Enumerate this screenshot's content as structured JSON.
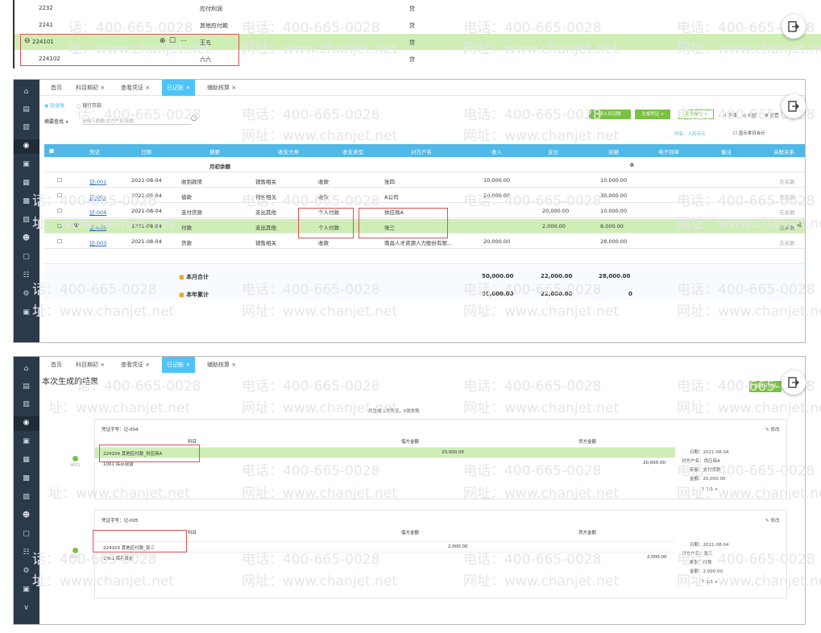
{
  "watermark": {
    "phone": "电话：400-665-0028",
    "site": "网址：www.chanjet.net",
    "phone_short": "话：400-665-0028",
    "site_short": "址：www.chanjet.net"
  },
  "panel1": {
    "rows": [
      {
        "code": "2232",
        "name": "应付利润",
        "dir": "贷"
      },
      {
        "code": "2241",
        "name": "其他应付款",
        "dir": "贷"
      },
      {
        "code": "224101",
        "name": "王五",
        "dir": "贷"
      },
      {
        "code": "224102",
        "name": "六六",
        "dir": "贷"
      }
    ]
  },
  "panel2": {
    "tabs": [
      "首页",
      "科目期初 ×",
      "查看凭证 ×",
      "日记账 ×",
      "辅助核算 ×"
    ],
    "subtabs": [
      "现金账",
      "银行存款"
    ],
    "search_scope": "摘要查找",
    "search_placeholder": "请输入摘要/对方户名/金额",
    "toolbar": {
      "import": "导入日记账",
      "gen_voucher": "生成凭证 ∨",
      "more": "更多操作 ∨",
      "download": "下载",
      "view": "视图",
      "settings": "设置",
      "unit_label": "所有：人民币元",
      "show_today": "显示本日合计"
    },
    "columns": [
      "凭证",
      "日期",
      "摘要",
      "收支大类",
      "收支类型",
      "对方户名",
      "收入",
      "支出",
      "余额",
      "电子回单",
      "备注",
      "关联关系"
    ],
    "opening_label": "月初余额",
    "opening_balance": "0",
    "rows": [
      {
        "voucher": "记-001",
        "date": "2021-08-04",
        "summary": "收到款项",
        "category": "销售相关",
        "type": "收款",
        "party": "张四",
        "income": "10,000.00",
        "expense": "",
        "balance": "10,000.00",
        "link": "去关联"
      },
      {
        "voucher": "记-002",
        "date": "2021-08-04",
        "summary": "借款",
        "category": "销售相关",
        "type": "收款",
        "party": "A公司",
        "income": "20,000.00",
        "expense": "",
        "balance": "30,000.00",
        "link": "去关联"
      },
      {
        "voucher": "记-004",
        "date": "2021-08-04",
        "summary": "支付货款",
        "category": "支出其他",
        "type": "个人付款",
        "party": "供应商A",
        "income": "",
        "expense": "20,000.00",
        "balance": "10,000.00",
        "link": "去关联"
      },
      {
        "voucher": "记-005",
        "date": "2021-08-04",
        "summary": "付款",
        "category": "支出其他",
        "type": "个人付款",
        "party": "张三",
        "income": "",
        "expense": "2,000.00",
        "balance": "8,000.00",
        "link": "去关联"
      },
      {
        "voucher": "记-003",
        "date": "2021-08-04",
        "summary": "货款",
        "category": "销售相关",
        "type": "收款",
        "party": "南昌人才资源人力股份有限...",
        "income": "20,000.00",
        "expense": "",
        "balance": "28,000.00",
        "link": "去关联"
      }
    ],
    "month_total": {
      "label": "本月合计",
      "income": "50,000.00",
      "expense": "22,000.00",
      "balance": "28,000.00"
    },
    "year_total": {
      "label": "本年累计",
      "income": "50,000.00",
      "expense": "22,000.00",
      "balance": "0"
    }
  },
  "panel3": {
    "tabs": [
      "首页",
      "科目期初 ×",
      "查看凭证 ×",
      "日记账 ×",
      "辅助核算 ×"
    ],
    "title": "本次生成的结果",
    "return_btn": "返回日记账",
    "summary_text": "共生成 2张凭证，0张失败",
    "vouchers": [
      {
        "no_label": "凭证字号：记-004",
        "edit": "修改",
        "col_subject": "科目",
        "col_debit": "借方金额",
        "col_credit": "贷方金额",
        "line1_subject": "224104 其他应付款_供应商A",
        "line1_debit": "20,000.00",
        "line2_subject": "1001 库存现金",
        "line2_credit": "20,000.00",
        "dot_label": "4001",
        "info": [
          "日期：2021-08-04",
          "对方户名：供应商A",
          "摘要：支付货款",
          "金额：20,000.00",
          "↑ 1/1 ∨"
        ]
      },
      {
        "no_label": "凭证字号：记-005",
        "edit": "修改",
        "col_subject": "科目",
        "col_debit": "借方金额",
        "col_credit": "贷方金额",
        "line1_subject": "224103 其他应付款_张三",
        "line1_debit": "2,000.00",
        "line2_subject": "1001 库存现金",
        "line2_credit": "2,000.00",
        "dot_label": "4001",
        "info": [
          "日期：2021-08-04",
          "对方户名：张三",
          "摘要：付款",
          "金额：2,000.00",
          "↑ 1/1 ∨"
        ]
      }
    ]
  },
  "colors": {
    "sidebar": "#2b3a4a",
    "header_blue": "#4fb8e6",
    "highlight_green": "#cfeeb6",
    "accent_green": "#7ac143",
    "red_box": "#e05050"
  }
}
